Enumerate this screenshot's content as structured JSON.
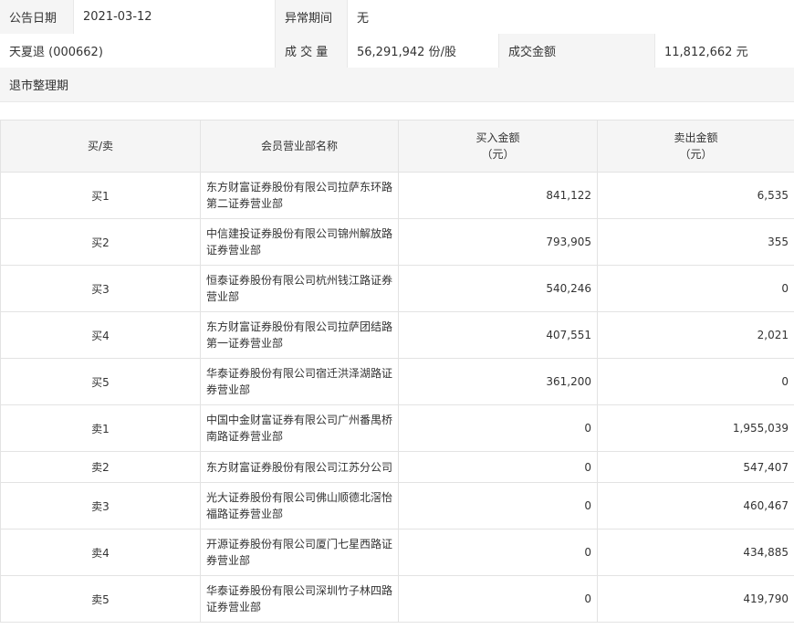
{
  "info": {
    "announce_date_label": "公告日期",
    "announce_date": "2021-03-12",
    "abnormal_period_label": "异常期间",
    "abnormal_period": "无",
    "stock_name": "天夏退 (000662)",
    "volume_label": "成 交 量",
    "volume": "56,291,942 份/股",
    "amount_label": "成交金额",
    "amount": "11,812,662 元",
    "reason": "退市整理期"
  },
  "table": {
    "headers": {
      "side": "买/卖",
      "branch": "会员营业部名称",
      "buy_line1": "买入金额",
      "buy_line2": "（元）",
      "sell_line1": "卖出金额",
      "sell_line2": "（元）"
    },
    "rows": [
      {
        "side": "买1",
        "branch_l1": "东方财富证券股份有限公司拉萨东环路",
        "branch_l2": "第二证券营业部",
        "buy": "841,122",
        "sell": "6,535"
      },
      {
        "side": "买2",
        "branch_l1": "中信建投证券股份有限公司锦州解放路",
        "branch_l2": "证券营业部",
        "buy": "793,905",
        "sell": "355"
      },
      {
        "side": "买3",
        "branch_l1": "恒泰证券股份有限公司杭州钱江路证券",
        "branch_l2": "营业部",
        "buy": "540,246",
        "sell": "0"
      },
      {
        "side": "买4",
        "branch_l1": "东方财富证券股份有限公司拉萨团结路",
        "branch_l2": "第一证券营业部",
        "buy": "407,551",
        "sell": "2,021"
      },
      {
        "side": "买5",
        "branch_l1": "华泰证券股份有限公司宿迁洪泽湖路证",
        "branch_l2": "券营业部",
        "buy": "361,200",
        "sell": "0"
      },
      {
        "side": "卖1",
        "branch_l1": "中国中金财富证券有限公司广州番禺桥",
        "branch_l2": "南路证券营业部",
        "buy": "0",
        "sell": "1,955,039"
      },
      {
        "side": "卖2",
        "branch_l1": "东方财富证券股份有限公司江苏分公司",
        "branch_l2": "",
        "buy": "0",
        "sell": "547,407"
      },
      {
        "side": "卖3",
        "branch_l1": "光大证券股份有限公司佛山顺德北滘怡",
        "branch_l2": "福路证券营业部",
        "buy": "0",
        "sell": "460,467"
      },
      {
        "side": "卖4",
        "branch_l1": "开源证券股份有限公司厦门七星西路证",
        "branch_l2": "券营业部",
        "buy": "0",
        "sell": "434,885"
      },
      {
        "side": "卖5",
        "branch_l1": "华泰证券股份有限公司深圳竹子林四路",
        "branch_l2": "证券营业部",
        "buy": "0",
        "sell": "419,790"
      }
    ]
  }
}
